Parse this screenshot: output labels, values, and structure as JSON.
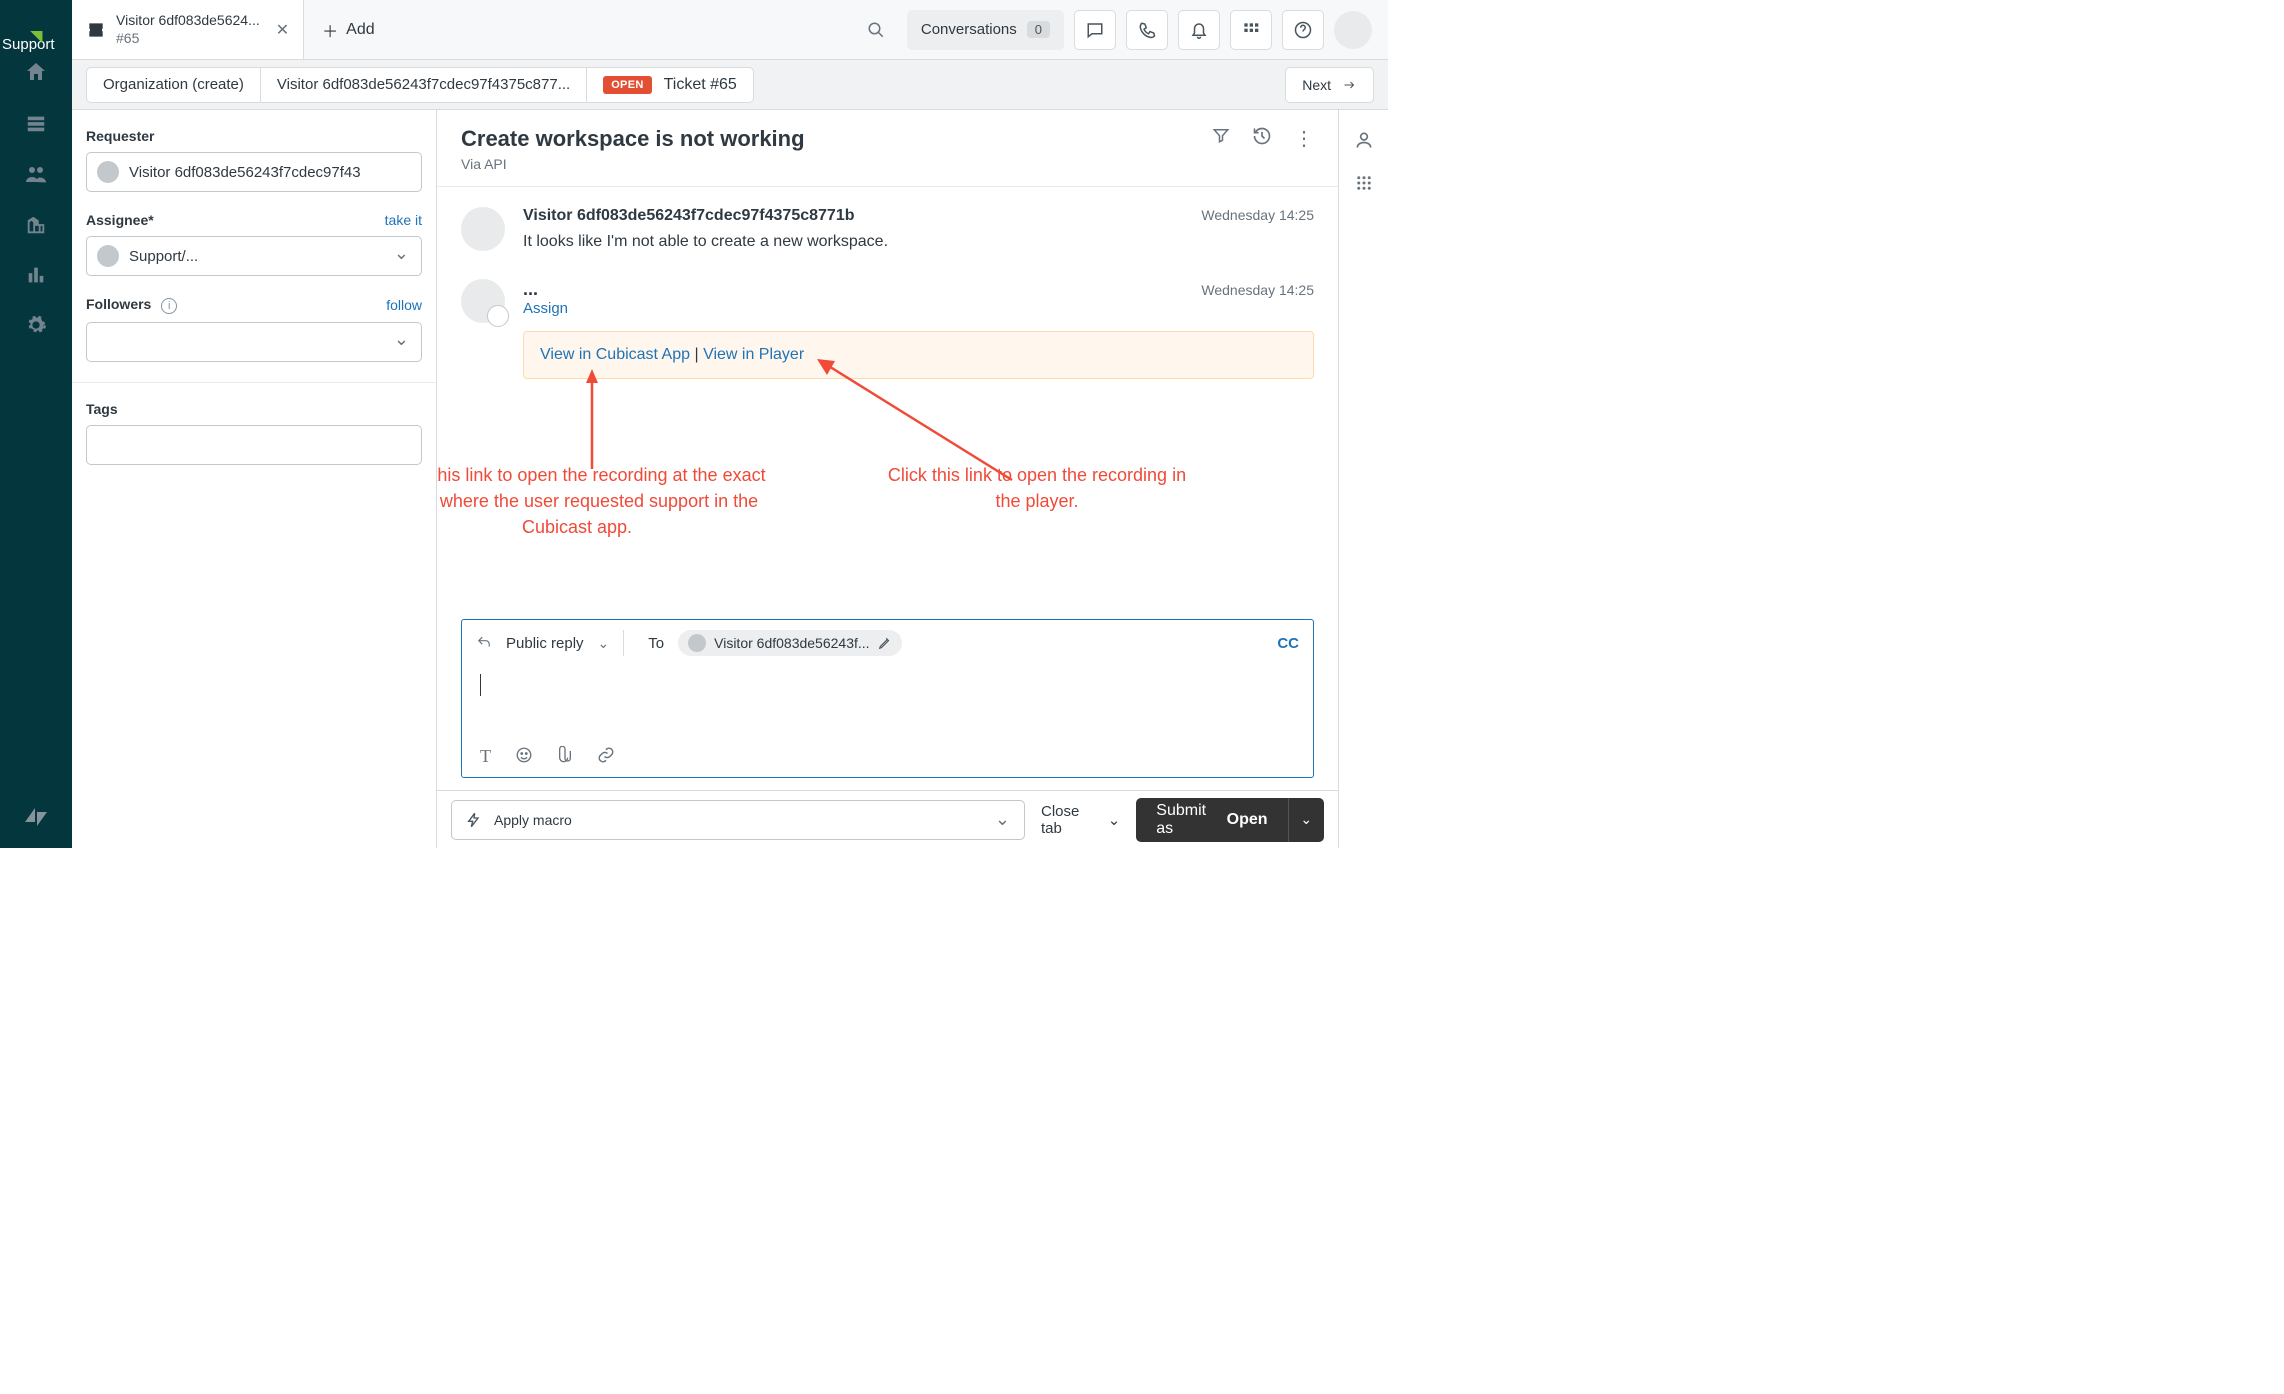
{
  "product_label": "Support",
  "tab": {
    "title": "Visitor 6df083de5624...",
    "subtitle": "#65"
  },
  "add_tab": "Add",
  "top_actions": {
    "conversations_label": "Conversations",
    "conversations_count": "0"
  },
  "breadcrumb": {
    "org": "Organization (create)",
    "visitor": "Visitor 6df083de56243f7cdec97f4375c877...",
    "ticket_status": "OPEN",
    "ticket_label": "Ticket #65",
    "next": "Next"
  },
  "sidebar": {
    "requester_label": "Requester",
    "requester_value": "Visitor 6df083de56243f7cdec97f43",
    "assignee_label": "Assignee*",
    "assignee_action": "take it",
    "assignee_value": "Support/...",
    "followers_label": "Followers",
    "followers_action": "follow",
    "tags_label": "Tags"
  },
  "conversation": {
    "title": "Create workspace is not working",
    "subtitle": "Via API",
    "messages": [
      {
        "author": "Visitor 6df083de56243f7cdec97f4375c8771b",
        "time": "Wednesday 14:25",
        "body": "It looks like I'm not able to create a new workspace."
      },
      {
        "author_dots": "...",
        "assign": "Assign",
        "time": "Wednesday 14:25",
        "note_link1": "View in Cubicast App",
        "note_sep": " | ",
        "note_link2": "View in Player"
      }
    ]
  },
  "annotations": {
    "left": "Click this link to open the recording at the exact point where the user requested support in the Cubicast app.",
    "right": "Click this link to open the recording in the player."
  },
  "reply": {
    "mode": "Public reply",
    "to_label": "To",
    "recipient": "Visitor 6df083de56243f...",
    "cc": "CC"
  },
  "footer": {
    "macro": "Apply macro",
    "close_tab": "Close tab",
    "submit_prefix": "Submit as ",
    "submit_status": "Open"
  }
}
